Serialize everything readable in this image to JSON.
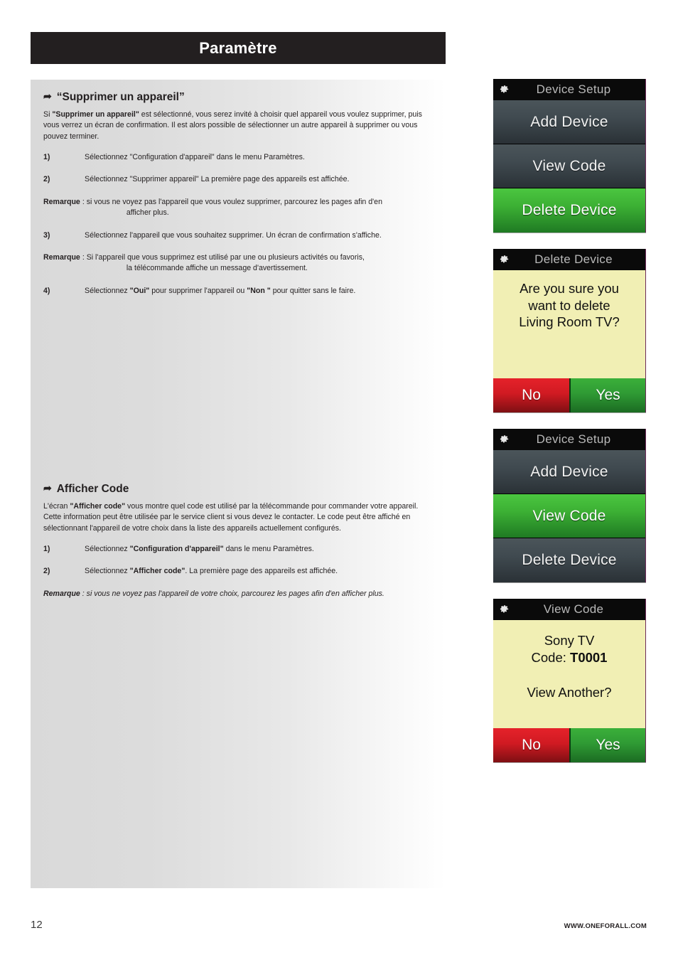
{
  "header": {
    "title": "Paramètre"
  },
  "sections": [
    {
      "heading": "“Supprimer un appareil”",
      "arrow": "arrow-bullet-icon",
      "intro_parts": {
        "a": "Si ",
        "b": "\"Supprimer un appareil\"",
        "c": " est sélectionné, vous serez invité à choisir quel appareil vous voulez supprimer, puis vous verrez un écran de confirmation. Il est alors possible de sélectionner un autre appareil à supprimer ou vous pouvez terminer."
      },
      "steps": [
        {
          "num": "1)",
          "text": "Sélectionnez \"Configuration d'appareil\" dans le menu Paramètres."
        },
        {
          "num": "2)",
          "text": "Sélectionnez \"Supprimer appareil\" La première page des appareils est affichée."
        }
      ],
      "note1": {
        "label": "Remarque",
        "body": " : si vous ne voyez pas l'appareil que vous voulez supprimer, parcourez les pages afin d'en",
        "cont": "afficher plus."
      },
      "step3": {
        "num": "3)",
        "text": "Sélectionnez l'appareil que vous souhaitez supprimer. Un écran de confirmation s'affiche."
      },
      "note2": {
        "label": "Remarque",
        "body": " : Si l'appareil que vous supprimez est utilisé par une ou plusieurs activités ou favoris,",
        "cont": "la  télécommande affiche un message d'avertissement."
      },
      "step4": {
        "num": "4)",
        "a": "Sélectionnez ",
        "b": "\"Oui\"",
        "c": " pour supprimer l'appareil ou ",
        "d": "\"Non \"",
        "e": " pour quitter sans le faire."
      }
    },
    {
      "heading": "Afficher Code",
      "arrow": "arrow-bullet-icon",
      "intro_parts": {
        "a": "L'écran ",
        "b": "\"Afficher code\"",
        "c": " vous montre quel code est utilisé par la télécommande pour commander votre appareil. Cette information peut être utilisée par le service client si vous devez le contacter. Le code peut être affiché en sélectionnant l'appareil de votre choix dans la liste des appareils actuellement configurés."
      },
      "step1": {
        "num": "1)",
        "a": "Sélectionnez ",
        "b": "\"Configuration d'appareil\"",
        "c": " dans le menu Paramètres."
      },
      "step2": {
        "num": "2)",
        "a": "Sélectionnez ",
        "b": "\"Afficher code\"",
        "c": ". La première page des appareils est affichée."
      },
      "note": {
        "label": "Remarque",
        "body": " : si vous ne voyez pas l'appareil de votre choix, parcourez les pages afin d'en afficher plus."
      }
    }
  ],
  "screens": [
    {
      "id": "device-setup-delete",
      "icon": "gear-icon",
      "title": "Device Setup",
      "rows": [
        {
          "label": "Add Device",
          "state": "dark"
        },
        {
          "label": "View Code",
          "state": "dark"
        },
        {
          "label": "Delete Device",
          "state": "green"
        }
      ]
    },
    {
      "id": "delete-device-confirm",
      "icon": "gear-icon",
      "title": "Delete Device",
      "message_lines": [
        "Are you sure you",
        "want to delete",
        "Living Room TV?"
      ],
      "buttons": {
        "no": "No",
        "yes": "Yes"
      }
    },
    {
      "id": "device-setup-view",
      "icon": "gear-icon",
      "title": "Device Setup",
      "rows": [
        {
          "label": "Add Device",
          "state": "dark"
        },
        {
          "label": "View Code",
          "state": "green"
        },
        {
          "label": "Delete Device",
          "state": "dark"
        }
      ]
    },
    {
      "id": "view-code-result",
      "icon": "gear-icon",
      "title": "View Code",
      "device_name": "Sony TV",
      "code_label": "Code: ",
      "code_value": "T0001",
      "prompt": "View Another?",
      "buttons": {
        "no": "No",
        "yes": "Yes"
      }
    }
  ],
  "footer": {
    "page_number": "12",
    "url": "WWW.ONEFORALL.COM"
  },
  "colors": {
    "title_bar": "#231f20",
    "accent_green": "#3cb034",
    "accent_red": "#d01a22",
    "screen_yellow": "#f1efb4",
    "panel_gray": "#d9d9d9"
  }
}
